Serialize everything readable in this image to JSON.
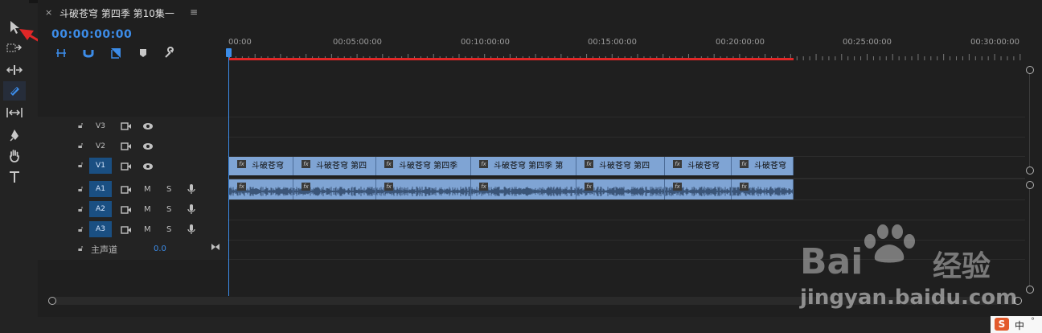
{
  "sequence": {
    "tab_close": "×",
    "title": "斗破苍穹 第四季 第10集一",
    "menu": "≡",
    "timecode": "00:00:00:00"
  },
  "ruler": {
    "labels": [
      "00:00",
      "00:05:00:00",
      "00:10:00:00",
      "00:15:00:00",
      "00:20:00:00",
      "00:25:00:00",
      "00:30:00:00"
    ]
  },
  "tracks": {
    "video": [
      {
        "name": "V3",
        "active": false
      },
      {
        "name": "V2",
        "active": false
      },
      {
        "name": "V1",
        "active": true
      }
    ],
    "audio": [
      {
        "name": "A1",
        "active": true,
        "m": "M",
        "s": "S"
      },
      {
        "name": "A2",
        "active": true,
        "m": "M",
        "s": "S"
      },
      {
        "name": "A3",
        "active": true,
        "m": "M",
        "s": "S"
      }
    ],
    "master": {
      "label": "主声道",
      "value": "0.0"
    }
  },
  "clips": {
    "video_labels": [
      "斗破苍穹",
      "斗破苍穹 第四",
      "斗破苍穹 第四季",
      "斗破苍穹 第四季 第",
      "斗破苍穹 第四",
      "斗破苍穹",
      "斗破苍穹"
    ],
    "fx": "fx"
  },
  "watermark": {
    "brand": "Bai",
    "brand2": "经验",
    "url": "jingyan.baidu.com"
  },
  "ime": {
    "s": "S",
    "lang": "中",
    "dot": "°"
  },
  "colors": {
    "accent": "#3c8ce8",
    "workarea": "#e02727",
    "clip": "#7fa4d4",
    "track_active": "#1a4f82"
  }
}
